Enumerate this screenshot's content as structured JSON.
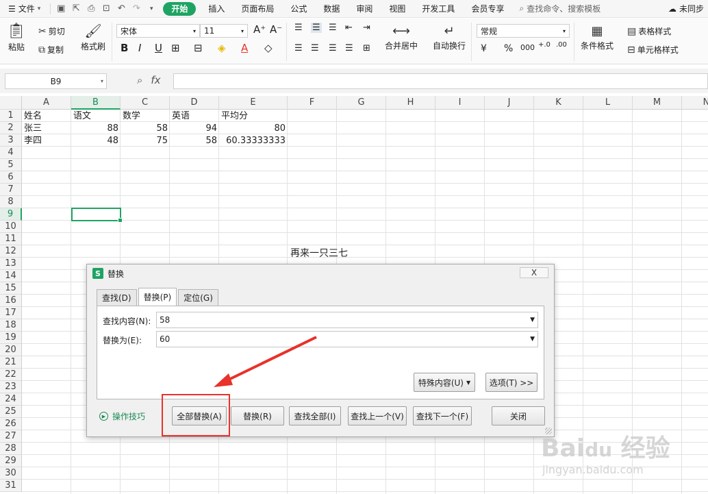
{
  "menubar": {
    "file_label": "文件",
    "tabs": [
      "开始",
      "插入",
      "页面布局",
      "公式",
      "数据",
      "审阅",
      "视图",
      "开发工具",
      "会员专享"
    ],
    "active_tab": "开始",
    "search_placeholder": "查找命令、搜索模板",
    "sync_label": "未同步"
  },
  "ribbon": {
    "paste": "粘贴",
    "cut": "剪切",
    "copy": "复制",
    "format_painter": "格式刷",
    "font_name": "宋体",
    "font_size": "11",
    "merge_center": "合并居中",
    "wrap_text": "自动换行",
    "number_format": "常规",
    "conditional_format": "条件格式",
    "table_style": "表格样式",
    "cell_style": "单元格样式"
  },
  "formula_bar": {
    "name_box": "B9",
    "fx_label": "fx",
    "value": ""
  },
  "columns": [
    "A",
    "B",
    "C",
    "D",
    "E",
    "F",
    "G",
    "H",
    "I",
    "J",
    "K",
    "L",
    "M",
    "N"
  ],
  "rows": [
    "1",
    "2",
    "3",
    "4",
    "5",
    "6",
    "7",
    "8",
    "9",
    "10",
    "11",
    "12",
    "13",
    "14",
    "15",
    "16",
    "17",
    "18",
    "19",
    "20",
    "21",
    "22",
    "23",
    "24",
    "25",
    "26",
    "27",
    "28",
    "29",
    "30",
    "31"
  ],
  "sheet": {
    "header": [
      "姓名",
      "语文",
      "数学",
      "英语",
      "平均分"
    ],
    "r2": [
      "张三",
      "88",
      "58",
      "94",
      "80"
    ],
    "r3": [
      "李四",
      "48",
      "75",
      "58",
      "60.33333333"
    ],
    "floating_text": "再来一只三七"
  },
  "dialog": {
    "title": "替换",
    "close_label": "X",
    "tabs": [
      "查找(D)",
      "替换(P)",
      "定位(G)"
    ],
    "find_label": "查找内容(N):",
    "find_value": "58",
    "replace_label": "替换为(E):",
    "replace_value": "60",
    "special_button": "特殊内容(U)",
    "options_button": "选项(T) >>",
    "tips_label": "操作技巧",
    "buttons": {
      "replace_all": "全部替换(A)",
      "replace": "替换(R)",
      "find_all": "查找全部(I)",
      "find_prev": "查找上一个(V)",
      "find_next": "查找下一个(F)",
      "close": "关闭"
    }
  },
  "watermark": {
    "text": "Baidu经验",
    "url": "jingyan.baidu.com"
  },
  "colors": {
    "accent": "#1fa363",
    "annotation": "#e8322a"
  }
}
